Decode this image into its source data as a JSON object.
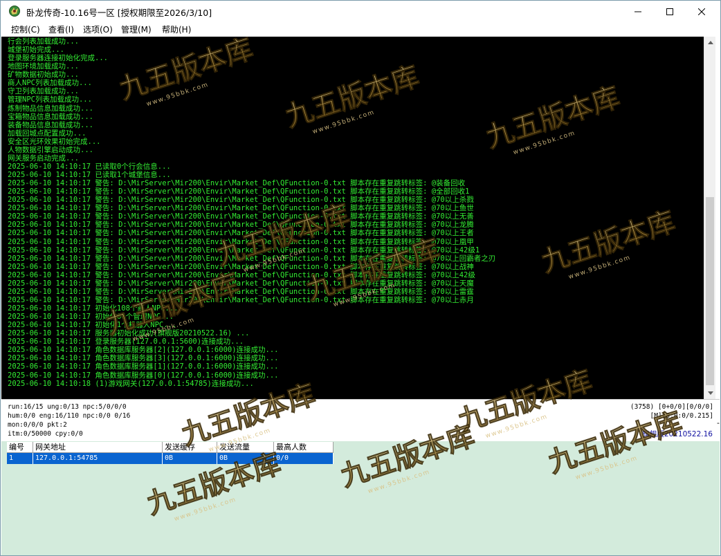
{
  "window": {
    "title": "卧龙传奇-10.16号一区 [授权期限至2026/3/10]"
  },
  "menu": [
    "控制(C)",
    "查看(I)",
    "选项(O)",
    "管理(M)",
    "帮助(H)"
  ],
  "log_lines": [
    "行会列表加载成功...",
    "城堡初始完成...",
    "登录服务器连接初始化完成...",
    "地图环境加载成功...",
    "矿物数据初始成功...",
    "商人NPC列表加载成功...",
    "守卫列表加载成功...",
    "管理NPC列表加载成功...",
    "炼制物品信息加载成功...",
    "宝箱物品信息加载成功...",
    "装备物品信息加载成功...",
    "加载回城点配置成功...",
    "安全区光环效果初始完成...",
    "人物数据引擎启动成功...",
    "网关服务启动完成...",
    "2025-06-10 14:10:17 已读取0个行会信息...",
    "2025-06-10 14:10:17 已读取1个城堡信息...",
    "2025-06-10 14:10:17 警告: D:\\MirServer\\Mir200\\Envir\\Market_Def\\QFunction-0.txt 脚本存在重复跳转标签: @装备回收",
    "2025-06-10 14:10:17 警告: D:\\MirServer\\Mir200\\Envir\\Market_Def\\QFunction-0.txt 脚本存在重复跳转标签: @全部回收1",
    "2025-06-10 14:10:17 警告: D:\\MirServer\\Mir200\\Envir\\Market_Def\\QFunction-0.txt 脚本存在重复跳转标签: @70以上杀戮",
    "2025-06-10 14:10:17 警告: D:\\MirServer\\Mir200\\Envir\\Market_Def\\QFunction-0.txt 脚本存在重复跳转标签: @70以上鱼世",
    "2025-06-10 14:10:17 警告: D:\\MirServer\\Mir200\\Envir\\Market_Def\\QFunction-0.txt 脚本存在重复跳转标签: @70以上无善",
    "2025-06-10 14:10:17 警告: D:\\MirServer\\Mir200\\Envir\\Market_Def\\QFunction-0.txt 脚本存在重复跳转标签: @70以上龙腾",
    "2025-06-10 14:10:17 警告: D:\\MirServer\\Mir200\\Envir\\Market_Def\\QFunction-0.txt 脚本存在重复跳转标签: @70以上王者",
    "2025-06-10 14:10:17 警告: D:\\MirServer\\Mir200\\Envir\\Market_Def\\QFunction-0.txt 脚本存在重复跳转标签: @70以上凰甲",
    "2025-06-10 14:10:17 警告: D:\\MirServer\\Mir200\\Envir\\Market_Def\\QFunction-0.txt 脚本存在重复跳转标签: @70以上42级1",
    "2025-06-10 14:10:17 警告: D:\\MirServer\\Mir200\\Envir\\Market_Def\\QFunction-0.txt 脚本存在重复跳转标签: @70以上回霸者之刃",
    "2025-06-10 14:10:17 警告: D:\\MirServer\\Mir200\\Envir\\Market_Def\\QFunction-0.txt 脚本存在重复跳转标签: @70以上战神",
    "2025-06-10 14:10:17 警告: D:\\MirServer\\Mir200\\Envir\\Market_Def\\QFunction-0.txt 脚本存在重复跳转标签: @70以上42级",
    "2025-06-10 14:10:17 警告: D:\\MirServer\\Mir200\\Envir\\Market_Def\\QFunction-0.txt 脚本存在重复跳转标签: @70以上天魔",
    "2025-06-10 14:10:17 警告: D:\\MirServer\\Mir200\\Envir\\Market_Def\\QFunction-0.txt 脚本存在重复跳转标签: @70以上雷霆",
    "2025-06-10 14:10:17 警告: D:\\MirServer\\Mir200\\Envir\\Market_Def\\QFunction-0.txt 脚本存在重复跳转标签: @70以上赤月",
    "2025-06-10 14:10:17 初始化108个商人NPC...",
    "2025-06-10 14:10:17 初始化66个管理NPC...",
    "2025-06-10 14:10:17 初始化1个机器人NPC...",
    "2025-06-10 14:10:17 服务器初始化成功(旗舰版20210522.16) ...",
    "2025-06-10 14:10:17 登录服务器(127.0.0.1:5600)连接成功...",
    "2025-06-10 14:10:17 角色数据库服务器[2](127.0.0.1:6000)连接成功...",
    "2025-06-10 14:10:17 角色数据库服务器[3](127.0.0.1:6000)连接成功...",
    "2025-06-10 14:10:17 角色数据库服务器[1](127.0.0.1:6000)连接成功...",
    "2025-06-10 14:10:17 角色数据库服务器[0](127.0.0.1:6000)连接成功...",
    "2025-06-10 14:10:18 (1)游戏网关(127.0.0.1:54785)连接成功..."
  ],
  "status": {
    "left": [
      "run:16/15 ung:0/13 npc:5/0/0/0",
      "hum:0/0 eng:16/110 npc:0/0 0/16",
      "mon:0/0/0 pkt:2",
      "itm:0/50000 cpy:0/0"
    ],
    "right": [
      "(3758) [0+0/0][0/0/0]",
      "[M][0:0:0/0.215]"
    ],
    "dash": "-",
    "version": "旗舰版20210522.16"
  },
  "gate_table": {
    "headers": [
      "编号",
      "网关地址",
      "发送缓存",
      "发送流量",
      "最高人数"
    ],
    "rows": [
      [
        "1",
        "127.0.0.1:54785",
        "0B",
        "0B",
        "0/0"
      ]
    ]
  },
  "watermark": {
    "text": "九五版本库",
    "url": "www.95bbk.com"
  },
  "colors": {
    "console_bg": "#000000",
    "console_text": "#33ee33",
    "selection": "#0a64d0",
    "gate_bg": "#d3ebdc",
    "version_text": "#1010a0"
  }
}
